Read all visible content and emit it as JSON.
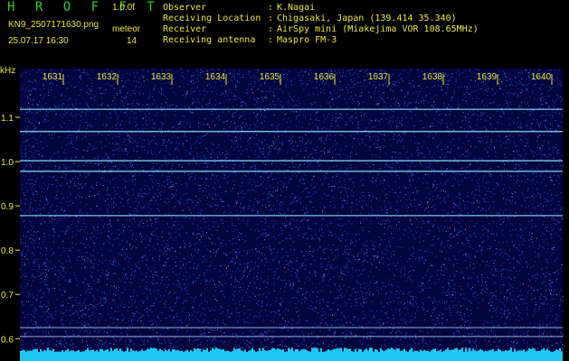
{
  "header": {
    "title": "H R O F F T",
    "version": "1.0.0f",
    "filename": "KN9_2507171630.png",
    "timestamp": "25.07.17 16:30",
    "mode_label": "meteor",
    "mode_value": "14",
    "info": [
      {
        "label": "Observer",
        "value": "K.Nagai"
      },
      {
        "label": "Receiving Location",
        "value": "Chigasaki, Japan (139.414 35.340)"
      },
      {
        "label": "Receiver",
        "value": "AirSpy mini (Miakejima VOR 108.65MHz)"
      },
      {
        "label": "Receiving antenna",
        "value": "Maspro FM-3"
      }
    ]
  },
  "chart_data": {
    "type": "heatmap",
    "ylabel": "kHz",
    "x_ticks": [
      "1631",
      "1632",
      "1633",
      "1634",
      "1635",
      "1636",
      "1637",
      "1638",
      "1639",
      "1640"
    ],
    "y_ticks": [
      "1.1",
      "1.0",
      "0.9",
      "0.8",
      "0.7",
      "0.6"
    ],
    "y_tick_values": [
      1.1,
      1.0,
      0.9,
      0.8,
      0.7,
      0.6
    ],
    "ylim": [
      0.57,
      1.21
    ],
    "carrier_lines_khz": [
      1.118,
      1.068,
      1.002,
      0.978,
      0.878
    ],
    "guide_lines_khz": [
      0.625,
      0.605
    ],
    "colors": {
      "background": "#03053f",
      "noise": "#3a6cff",
      "carrier": "#8fe8ff",
      "text": "#e8e83c",
      "title": "#2ecc2e",
      "floor": "#1ec8ee"
    }
  }
}
